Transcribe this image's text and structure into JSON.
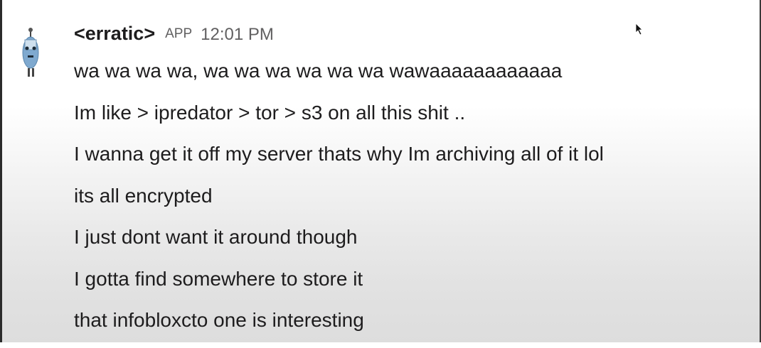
{
  "message": {
    "username": "<erratic>",
    "app_badge": "APP",
    "timestamp": "12:01 PM",
    "lines": [
      "wa wa wa wa, wa wa wa wa wa wa wawaaaaaaaaaaaa",
      "Im like > ipredator > tor > s3 on all this shit ..",
      "I wanna get it off my server thats why Im archiving all of it lol",
      "its all encrypted",
      "I just dont want it around though",
      "I gotta find somewhere to store it",
      "that infobloxcto one is interesting"
    ]
  },
  "colors": {
    "text": "#1d1c1d",
    "muted": "#616061",
    "avatar": "#7fa9cf"
  },
  "icons": {
    "avatar": "robot-avatar-icon",
    "cursor": "mouse-cursor-icon"
  }
}
